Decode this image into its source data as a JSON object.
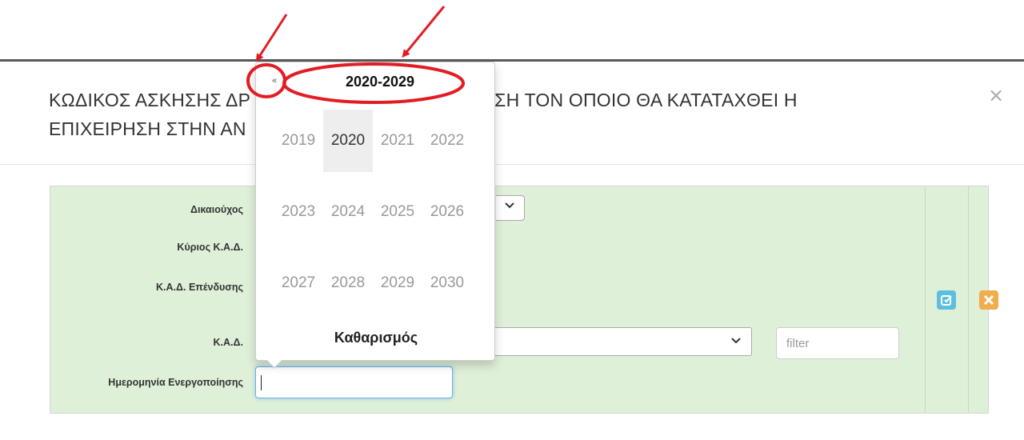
{
  "modal": {
    "title": "ΚΩΔΙΚΟΣ ΑΣΚΗΣΗΣ ΔΡ",
    "title_tail": ") ΜΕ ΒΑΣΗ ΤΟΝ ΟΠΟΙΟ ΘΑ ΚΑΤΑΤΑΧΘΕΙ Η",
    "title_line2": "ΕΠΙΧΕΙΡΗΣΗ ΣΤΗΝ ΑΝ",
    "close": "×"
  },
  "form": {
    "beneficiary_label": "Δικαιούχος",
    "main_kad_label": "Κύριος Κ.Α.Δ.",
    "investment_kad_label": "Κ.Α.Δ. Επένδυσης",
    "kad_label": "Κ.Α.Δ.",
    "activation_date_label": "Ημερομηνία Ενεργοποίησης",
    "filter_placeholder": "filter",
    "activation_date_value": ""
  },
  "datepicker": {
    "prev": "«",
    "decade": "2020-2029",
    "years": [
      "2019",
      "2020",
      "2021",
      "2022",
      "2023",
      "2024",
      "2025",
      "2026",
      "2027",
      "2028",
      "2029",
      "2030"
    ],
    "selected_year": "2020",
    "clear": "Καθαρισμός"
  },
  "actions": {
    "edit_icon": "edit-icon",
    "cancel_icon": "close-icon"
  },
  "colors": {
    "row_bg": "#dff0d8",
    "edit_btn": "#5bc0de",
    "cancel_btn": "#f0ad4e",
    "annotation": "#e31c24"
  }
}
